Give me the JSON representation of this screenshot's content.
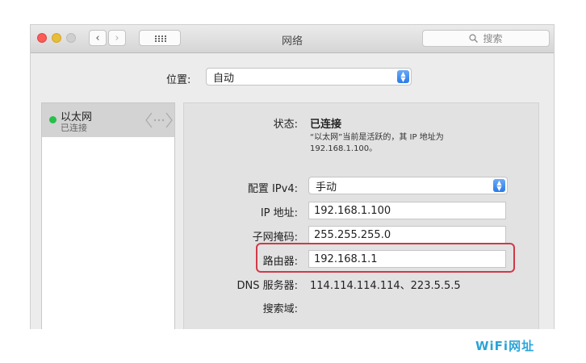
{
  "window": {
    "title": "网络",
    "search_placeholder": "搜索"
  },
  "location": {
    "label": "位置:",
    "value": "自动"
  },
  "sidebar": {
    "items": [
      {
        "name": "以太网",
        "status": "已连接",
        "status_color": "#26c04a"
      }
    ]
  },
  "details": {
    "status_label": "状态:",
    "status_value": "已连接",
    "status_desc_line1": "“以太网”当前是活跃的，其 IP 地址为",
    "status_desc_line2": "192.168.1.100。",
    "ipv4_label": "配置 IPv4:",
    "ipv4_value": "手动",
    "ip_label": "IP 地址:",
    "ip_value": "192.168.1.100",
    "subnet_label": "子网掩码:",
    "subnet_value": "255.255.255.0",
    "router_label": "路由器:",
    "router_value": "192.168.1.1",
    "dns_label": "DNS 服务器:",
    "dns_value": "114.114.114.114、223.5.5.5",
    "search_domain_label": "搜索域:"
  },
  "highlight_color": "#cf3a48",
  "watermark": "WiFi网址"
}
